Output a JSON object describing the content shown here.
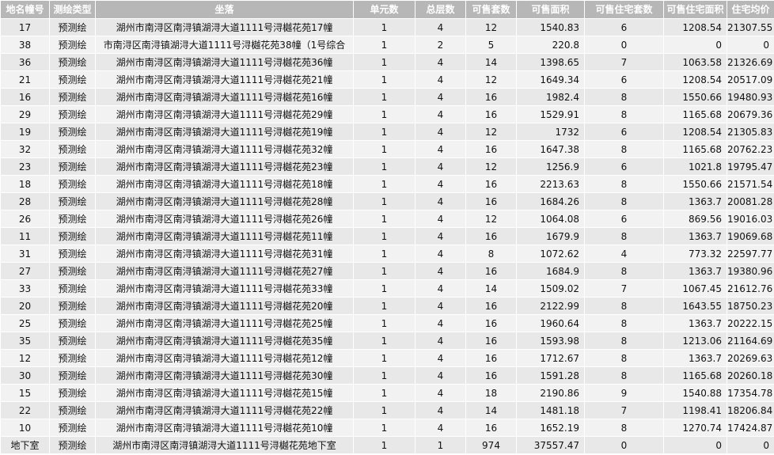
{
  "table": {
    "headers": [
      "地名幢号",
      "测绘类型",
      "坐落",
      "单元数",
      "总层数",
      "可售套数",
      "可售面积",
      "可售住宅套数",
      "可售住宅面积",
      "住宅均价"
    ],
    "rows": [
      [
        "17",
        "预测绘",
        "湖州市南浔区南浔镇湖浔大道1111号浔樾花苑17幢",
        "1",
        "4",
        "12",
        "1540.83",
        "6",
        "1208.54",
        "21307.55"
      ],
      [
        "38",
        "预测绘",
        "市南浔区南浔镇湖浔大道1111号浔樾花苑38幢（1号综合",
        "1",
        "2",
        "5",
        "220.8",
        "0",
        "0",
        "0"
      ],
      [
        "36",
        "预测绘",
        "湖州市南浔区南浔镇湖浔大道1111号浔樾花苑36幢",
        "1",
        "4",
        "14",
        "1398.65",
        "7",
        "1063.58",
        "21326.69"
      ],
      [
        "21",
        "预测绘",
        "湖州市南浔区南浔镇湖浔大道1111号浔樾花苑21幢",
        "1",
        "4",
        "12",
        "1649.34",
        "6",
        "1208.54",
        "20517.09"
      ],
      [
        "16",
        "预测绘",
        "湖州市南浔区南浔镇湖浔大道1111号浔樾花苑16幢",
        "1",
        "4",
        "16",
        "1982.4",
        "8",
        "1550.66",
        "19480.93"
      ],
      [
        "29",
        "预测绘",
        "湖州市南浔区南浔镇湖浔大道1111号浔樾花苑29幢",
        "1",
        "4",
        "16",
        "1529.91",
        "8",
        "1165.68",
        "20679.36"
      ],
      [
        "19",
        "预测绘",
        "湖州市南浔区南浔镇湖浔大道1111号浔樾花苑19幢",
        "1",
        "4",
        "12",
        "1732",
        "6",
        "1208.54",
        "21305.83"
      ],
      [
        "32",
        "预测绘",
        "湖州市南浔区南浔镇湖浔大道1111号浔樾花苑32幢",
        "1",
        "4",
        "16",
        "1647.38",
        "8",
        "1165.68",
        "20762.23"
      ],
      [
        "23",
        "预测绘",
        "湖州市南浔区南浔镇湖浔大道1111号浔樾花苑23幢",
        "1",
        "4",
        "12",
        "1256.9",
        "6",
        "1021.8",
        "19795.47"
      ],
      [
        "18",
        "预测绘",
        "湖州市南浔区南浔镇湖浔大道1111号浔樾花苑18幢",
        "1",
        "4",
        "16",
        "2213.63",
        "8",
        "1550.66",
        "21571.54"
      ],
      [
        "28",
        "预测绘",
        "湖州市南浔区南浔镇湖浔大道1111号浔樾花苑28幢",
        "1",
        "4",
        "16",
        "1684.26",
        "8",
        "1363.7",
        "20081.28"
      ],
      [
        "26",
        "预测绘",
        "湖州市南浔区南浔镇湖浔大道1111号浔樾花苑26幢",
        "1",
        "4",
        "12",
        "1064.08",
        "6",
        "869.56",
        "19016.03"
      ],
      [
        "11",
        "预测绘",
        "湖州市南浔区南浔镇湖浔大道1111号浔樾花苑11幢",
        "1",
        "4",
        "16",
        "1679.9",
        "8",
        "1363.7",
        "19069.68"
      ],
      [
        "31",
        "预测绘",
        "湖州市南浔区南浔镇湖浔大道1111号浔樾花苑31幢",
        "1",
        "4",
        "8",
        "1072.62",
        "4",
        "773.32",
        "22597.77"
      ],
      [
        "27",
        "预测绘",
        "湖州市南浔区南浔镇湖浔大道1111号浔樾花苑27幢",
        "1",
        "4",
        "16",
        "1684.9",
        "8",
        "1363.7",
        "19380.96"
      ],
      [
        "33",
        "预测绘",
        "湖州市南浔区南浔镇湖浔大道1111号浔樾花苑33幢",
        "1",
        "4",
        "14",
        "1509.02",
        "7",
        "1067.45",
        "21612.76"
      ],
      [
        "20",
        "预测绘",
        "湖州市南浔区南浔镇湖浔大道1111号浔樾花苑20幢",
        "1",
        "4",
        "16",
        "2122.99",
        "8",
        "1643.55",
        "18750.23"
      ],
      [
        "25",
        "预测绘",
        "湖州市南浔区南浔镇湖浔大道1111号浔樾花苑25幢",
        "1",
        "4",
        "16",
        "1960.64",
        "8",
        "1363.7",
        "20222.15"
      ],
      [
        "35",
        "预测绘",
        "湖州市南浔区南浔镇湖浔大道1111号浔樾花苑35幢",
        "1",
        "4",
        "16",
        "1593.98",
        "8",
        "1213.06",
        "21164.69"
      ],
      [
        "12",
        "预测绘",
        "湖州市南浔区南浔镇湖浔大道1111号浔樾花苑12幢",
        "1",
        "4",
        "16",
        "1712.67",
        "8",
        "1363.7",
        "20269.63"
      ],
      [
        "30",
        "预测绘",
        "湖州市南浔区南浔镇湖浔大道1111号浔樾花苑30幢",
        "1",
        "4",
        "16",
        "1591.28",
        "8",
        "1165.68",
        "20260.18"
      ],
      [
        "15",
        "预测绘",
        "湖州市南浔区南浔镇湖浔大道1111号浔樾花苑15幢",
        "1",
        "4",
        "18",
        "2190.86",
        "9",
        "1540.88",
        "17354.78"
      ],
      [
        "22",
        "预测绘",
        "湖州市南浔区南浔镇湖浔大道1111号浔樾花苑22幢",
        "1",
        "4",
        "14",
        "1481.18",
        "7",
        "1198.41",
        "18206.84"
      ],
      [
        "10",
        "预测绘",
        "湖州市南浔区南浔镇湖浔大道1111号浔樾花苑10幢",
        "1",
        "4",
        "16",
        "1652.19",
        "8",
        "1270.74",
        "17424.87"
      ],
      [
        "地下室",
        "预测绘",
        "湖州市南浔区南浔镇湖浔大道1111号浔樾花苑地下室",
        "1",
        "1",
        "974",
        "37557.47",
        "0",
        "0",
        "0"
      ]
    ]
  }
}
